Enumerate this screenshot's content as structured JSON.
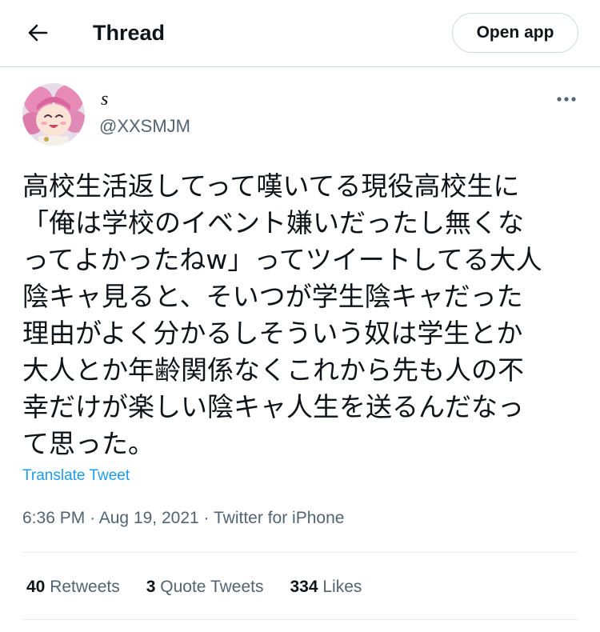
{
  "header": {
    "title": "Thread",
    "open_app_label": "Open app",
    "back_icon": "arrow-left-icon"
  },
  "tweet": {
    "display_name": "s",
    "handle": "@XXSMJM",
    "text": "高校生活返してって嘆いてる現役高校生に\n「俺は学校のイベント嫌いだったし無くな\nってよかったねw」ってツイートしてる大人\n陰キャ見ると、そいつが学生陰キャだった\n理由がよく分かるしそういう奴は学生とか\n大人とか年齢関係なくこれから先も人の不\n幸だけが楽しい陰キャ人生を送るんだなっ\nて思った。",
    "translate_label": "Translate Tweet",
    "time": "6:36 PM",
    "date": "Aug 19, 2021",
    "source": "Twitter for iPhone",
    "separator": "·"
  },
  "stats": {
    "retweets_count": "40",
    "retweets_label": "Retweets",
    "quotes_count": "3",
    "quotes_label": "Quote Tweets",
    "likes_count": "334",
    "likes_label": "Likes"
  },
  "colors": {
    "link": "#1d9bf0",
    "secondary_text": "#536471",
    "border": "#cfd9de"
  }
}
